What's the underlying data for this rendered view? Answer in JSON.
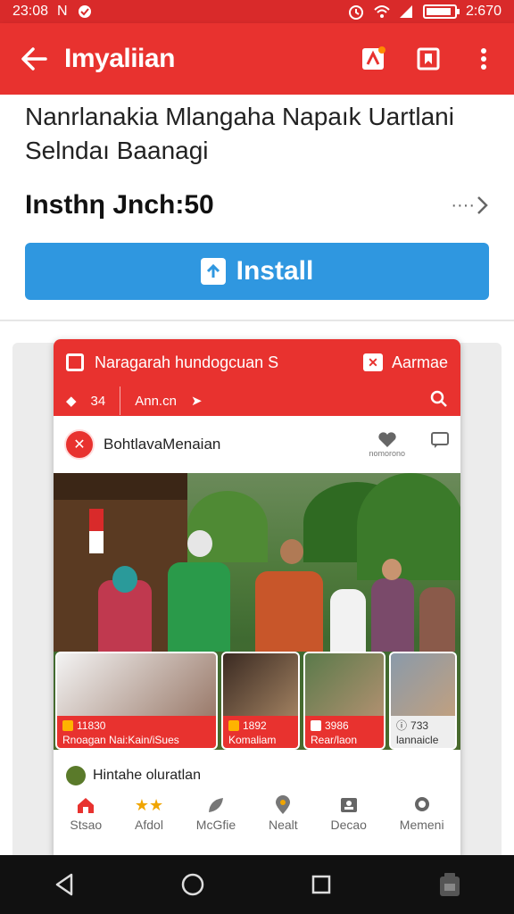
{
  "status_bar": {
    "time_left": "23:08",
    "carrier": "N",
    "time_right": "2:670",
    "battery_level": 0.9
  },
  "app_bar": {
    "title": "Imyaliian",
    "icons": [
      "back-arrow-icon",
      "share-icon",
      "bookmark-icon",
      "more-vert-icon"
    ],
    "color": "#e8322f"
  },
  "listing": {
    "title": "Nanrlanakia Mlangaha Napaık Uartlani Selndaı Ваanagi",
    "price": "Insthη Jnch:50",
    "more_label": "····",
    "install_label": "Install"
  },
  "preview": {
    "header_title": "Naragarah hundogcuan S",
    "header_action": "Aarmae",
    "header_count": "34",
    "header_location": "Ann.cn",
    "post_author": "BohtlavaMenaian",
    "post_action_label": "nomorono",
    "thumbs": [
      {
        "num": "11830",
        "caption": "Rnoagan Nai:Kain/iSues"
      },
      {
        "num": "1892",
        "caption": "Komaliam"
      },
      {
        "num": "3986",
        "caption": "Rear/laon"
      },
      {
        "num": "733",
        "caption": "lannaicle"
      }
    ],
    "hint": "Hintahe oluratlan",
    "nav": [
      {
        "label": "Stsao",
        "icon": "home-icon"
      },
      {
        "label": "Afdol",
        "icon": "stars-icon"
      },
      {
        "label": "McGfie",
        "icon": "leaf-icon"
      },
      {
        "label": "Nealt",
        "icon": "location-icon"
      },
      {
        "label": "Decao",
        "icon": "portrait-icon"
      },
      {
        "label": "Memeni",
        "icon": "message-icon"
      }
    ]
  }
}
